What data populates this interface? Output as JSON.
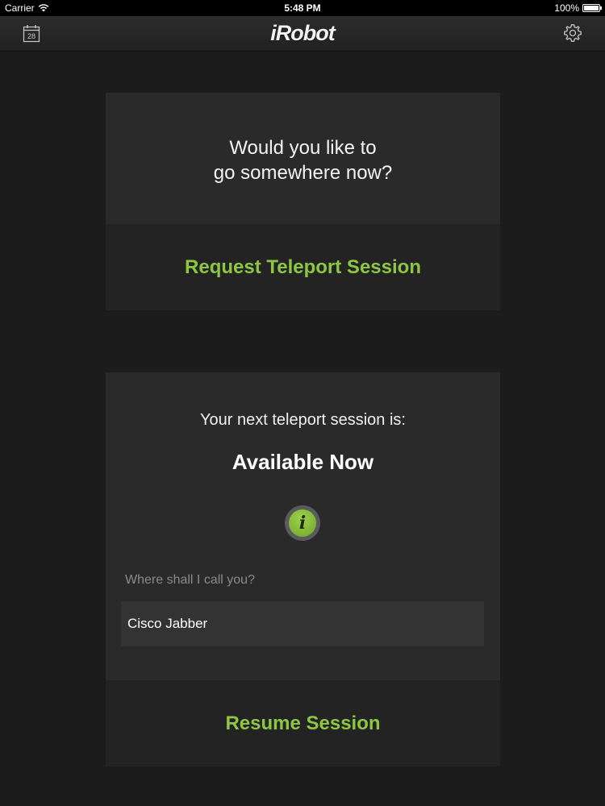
{
  "status_bar": {
    "carrier": "Carrier",
    "time": "5:48 PM",
    "battery": "100%"
  },
  "nav": {
    "logo": "iRobot",
    "calendar_day": "28",
    "calendar_icon": "calendar-icon",
    "settings_icon": "gear-icon"
  },
  "request_card": {
    "prompt_line1": "Would you like to",
    "prompt_line2": "go somewhere now?",
    "action_label": "Request Teleport Session"
  },
  "session_card": {
    "next_label": "Your next teleport session is:",
    "status": "Available Now",
    "info_icon": "info-icon",
    "info_glyph": "i",
    "field_label": "Where shall I call you?",
    "call_value": "Cisco Jabber",
    "action_label": "Resume Session"
  },
  "colors": {
    "accent_green": "#8dc642",
    "background": "#1c1c1d",
    "card": "#2a2a2b"
  }
}
